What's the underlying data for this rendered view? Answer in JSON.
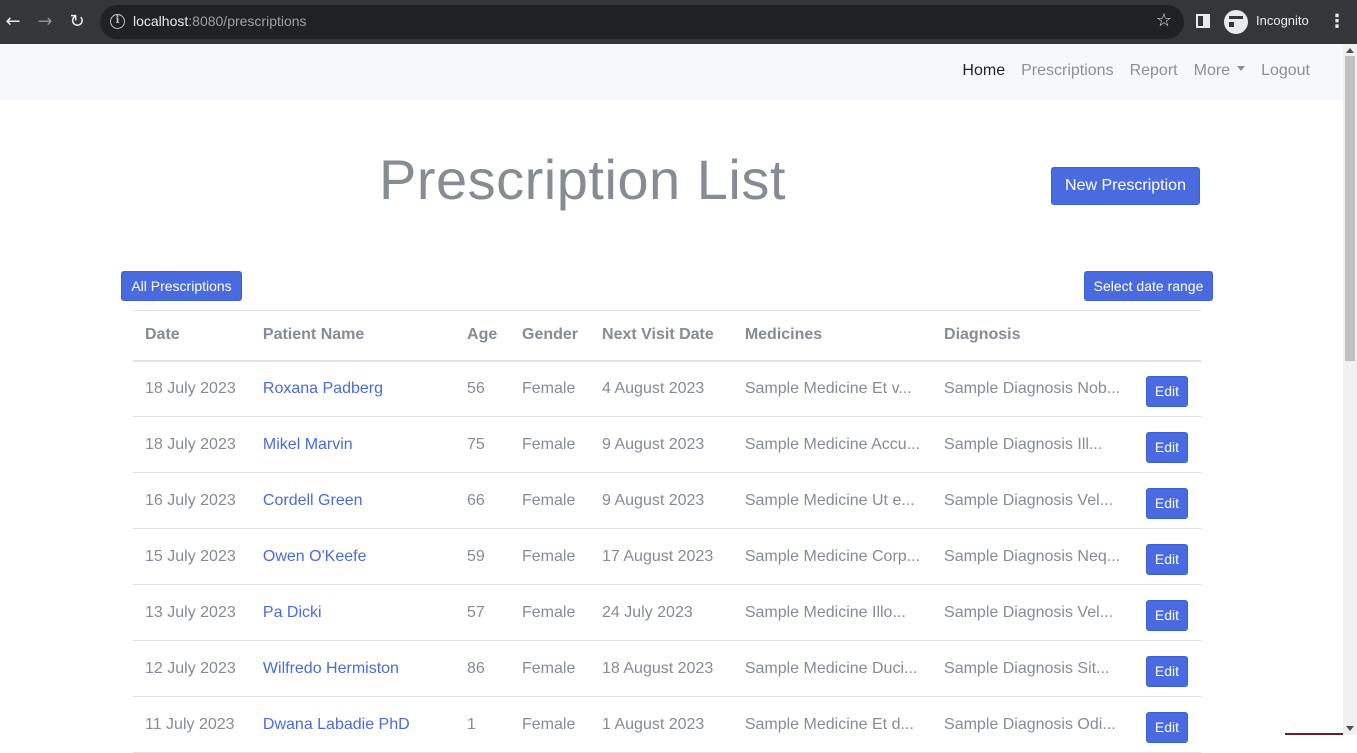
{
  "browser": {
    "url_host": "localhost",
    "url_rest": ":8080/prescriptions",
    "profile_label": "Incognito"
  },
  "nav": {
    "home": "Home",
    "prescriptions": "Prescriptions",
    "report": "Report",
    "more": "More",
    "logout": "Logout"
  },
  "page": {
    "title": "Prescription List",
    "new_button": "New Prescription",
    "all_button": "All Prescriptions",
    "range_button": "Select date range"
  },
  "table": {
    "headers": [
      "Date",
      "Patient Name",
      "Age",
      "Gender",
      "Next Visit Date",
      "Medicines",
      "Diagnosis"
    ],
    "edit_label": "Edit",
    "rows": [
      {
        "date": "18 July 2023",
        "name": "Roxana Padberg",
        "age": "56",
        "gender": "Female",
        "next": "4 August 2023",
        "medicines": "Sample Medicine Et v...",
        "diagnosis": "Sample Diagnosis Nob..."
      },
      {
        "date": "18 July 2023",
        "name": "Mikel Marvin",
        "age": "75",
        "gender": "Female",
        "next": "9 August 2023",
        "medicines": "Sample Medicine Accu...",
        "diagnosis": "Sample Diagnosis Ill..."
      },
      {
        "date": "16 July 2023",
        "name": "Cordell Green",
        "age": "66",
        "gender": "Female",
        "next": "9 August 2023",
        "medicines": "Sample Medicine Ut e...",
        "diagnosis": "Sample Diagnosis Vel..."
      },
      {
        "date": "15 July 2023",
        "name": "Owen O'Keefe",
        "age": "59",
        "gender": "Female",
        "next": "17 August 2023",
        "medicines": "Sample Medicine Corp...",
        "diagnosis": "Sample Diagnosis Neq..."
      },
      {
        "date": "13 July 2023",
        "name": "Pa Dicki",
        "age": "57",
        "gender": "Female",
        "next": "24 July 2023",
        "medicines": "Sample Medicine Illo...",
        "diagnosis": "Sample Diagnosis Vel..."
      },
      {
        "date": "12 July 2023",
        "name": "Wilfredo Hermiston",
        "age": "86",
        "gender": "Female",
        "next": "18 August 2023",
        "medicines": "Sample Medicine Duci...",
        "diagnosis": "Sample Diagnosis Sit..."
      },
      {
        "date": "11 July 2023",
        "name": "Dwana Labadie PhD",
        "age": "1",
        "gender": "Female",
        "next": "1 August 2023",
        "medicines": "Sample Medicine Et d...",
        "diagnosis": "Sample Diagnosis Odi..."
      }
    ]
  },
  "colors": {
    "accent": "#4a6be0",
    "navbar_bg": "#f7f8fb",
    "muted_text": "#868b94"
  }
}
